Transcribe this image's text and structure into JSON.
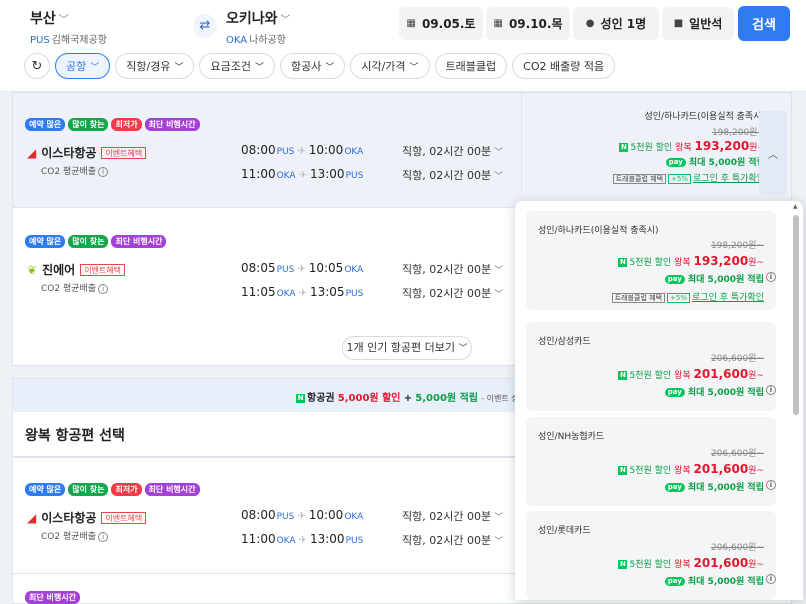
{
  "header": {
    "from": {
      "city": "부산",
      "code": "PUS",
      "airport": "김해국제공항"
    },
    "to": {
      "city": "오키나와",
      "code": "OKA",
      "airport": "나하공항"
    },
    "depart_date": "09.05.토",
    "return_date": "09.10.목",
    "passengers": "성인 1명",
    "seat_class": "일반석",
    "search_label": "검색"
  },
  "filters": [
    "공항",
    "직항/경유",
    "요금조건",
    "항공사",
    "시각/가격",
    "트래블클럽",
    "CO2 배출량 적음"
  ],
  "common": {
    "event_tag": "이벤트혜택",
    "co2_label": "CO2 평균배출",
    "info_glyph": "i",
    "won_suffix": "원~",
    "round_trip": "왕복",
    "discount_5k": "5천원 할인",
    "max_point": "최대 5,000원 적립",
    "npay": "pay",
    "travel_club": "트래블클럽 혜택",
    "login_link": "로그인 후 특가확인",
    "naver_n": "N",
    "small_tag": "+5%"
  },
  "flights": [
    {
      "badges": [
        "예약 많은",
        "많이 찾는",
        "최저가",
        "최단 비행시간"
      ],
      "airline": "이스타항공",
      "legs": [
        {
          "dep": "08:00",
          "dep_ap": "PUS",
          "arr": "10:00",
          "arr_ap": "OKA",
          "duration": "직항, 02시간 00분"
        },
        {
          "dep": "11:00",
          "dep_ap": "OKA",
          "arr": "13:00",
          "arr_ap": "PUS",
          "duration": "직항, 02시간 00분"
        }
      ],
      "price": {
        "card": "성인/하나카드(이용실적 충족시)",
        "original": "198,200원~",
        "price": "193,200"
      }
    },
    {
      "badges": [
        "예약 많은",
        "많이 찾는",
        "최단 비행시간"
      ],
      "airline": "진에어",
      "legs": [
        {
          "dep": "08:05",
          "dep_ap": "PUS",
          "arr": "10:05",
          "arr_ap": "OKA",
          "duration": "직항, 02시간 00분"
        },
        {
          "dep": "11:05",
          "dep_ap": "OKA",
          "arr": "13:05",
          "arr_ap": "PUS",
          "duration": "직항, 02시간 00분"
        }
      ]
    },
    {
      "badges": [
        "예약 많은",
        "많이 찾는",
        "최저가",
        "최단 비행시간"
      ],
      "airline": "이스타항공",
      "legs": [
        {
          "dep": "08:00",
          "dep_ap": "PUS",
          "arr": "10:00",
          "arr_ap": "OKA",
          "duration": "직항, 02시간 00분"
        },
        {
          "dep": "11:00",
          "dep_ap": "OKA",
          "arr": "13:00",
          "arr_ap": "PUS",
          "duration": "직항, 02시간 00분"
        }
      ]
    }
  ],
  "more_button": "1개 인기 항공편 더보기",
  "banner": {
    "part1": "항공권",
    "part2": "5,000원 할인",
    "part3": "+",
    "part4": "5,000원 적립",
    "part5": "- 이벤트 상품 한정"
  },
  "section_title": "왕복 항공편 선택",
  "partial_badge": "최단 비행시간",
  "dropdown": [
    {
      "card": "성인/하나카드(이용실적 충족시)",
      "original": "198,200원~",
      "price": "193,200",
      "travel": true
    },
    {
      "card": "성인/삼성카드",
      "original": "206,600원~",
      "price": "201,600",
      "travel": false
    },
    {
      "card": "성인/NH농협카드",
      "original": "206,600원~",
      "price": "201,600",
      "travel": false
    },
    {
      "card": "성인/롯데카드",
      "original": "206,600원~",
      "price": "201,600",
      "travel": false
    }
  ],
  "colors": {
    "accent": "#2f7bf2",
    "price_red": "#e3162b",
    "naver_green": "#03c75a"
  }
}
